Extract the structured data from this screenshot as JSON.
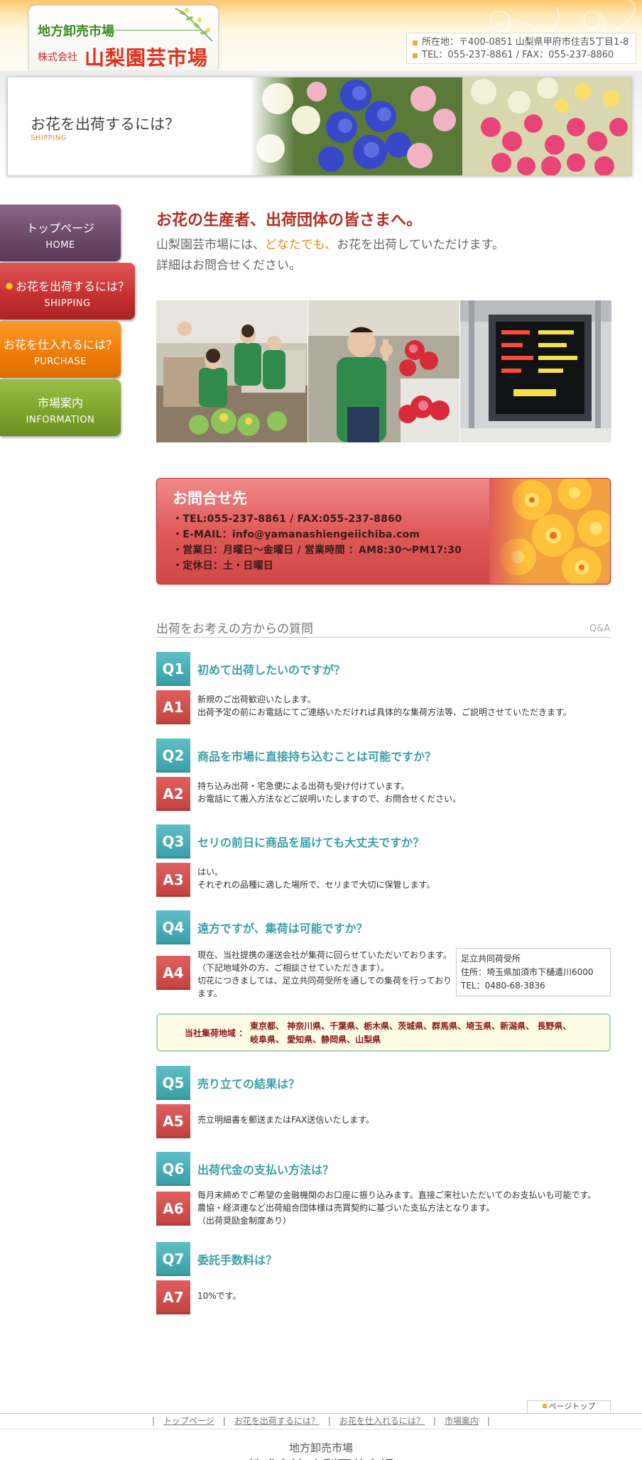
{
  "header": {
    "logo_line1": "地方卸売市場",
    "logo_company": "株式会社",
    "logo_name": "山梨園芸市場",
    "address": "所在地：〒400-0851 山梨県甲府市住吉5丁目1-8",
    "tel_fax": "TEL：055-237-8861 / FAX：055-237-8860"
  },
  "banner": {
    "title": "お花を出荷するには？",
    "subtitle": "SHIPPING"
  },
  "nav": [
    {
      "jp": "トップページ",
      "en": "HOME"
    },
    {
      "jp": "お花を出荷するには？",
      "en": "SHIPPING"
    },
    {
      "jp": "お花を仕入れるには？",
      "en": "PURCHASE"
    },
    {
      "jp": "市場案内",
      "en": "INFORMATION"
    }
  ],
  "intro": {
    "headline": "お花の生産者、出荷団体の皆さまへ。",
    "line2_a": "山梨園芸市場には、",
    "line2_highlight": "どなたでも、",
    "line2_b": "お花を出荷していただけます。",
    "line3": "詳細はお問合せください。"
  },
  "contact": {
    "title": "お問合せ先",
    "lines": [
      "・TEL:055-237-8861 / FAX:055-237-8860",
      "・E-MAIL：info@yamanashiengeiichiba.com",
      "・営業日：月曜日～金曜日 / 営業時間 ：AM8:30～PM17:30",
      "・定休日：土・日曜日"
    ]
  },
  "qa": {
    "heading": "出荷をお考えの方からの質問",
    "tag": "Q&A",
    "items": [
      {
        "q_badge": "Q1",
        "q": "初めて出荷したいのですが？",
        "a_badge": "A1",
        "a": [
          "新規のご出荷歓迎いたします。",
          "出荷予定の前にお電話にてご連絡いただければ具体的な集荷方法等、ご説明させていただきます。"
        ]
      },
      {
        "q_badge": "Q2",
        "q": "商品を市場に直接持ち込むことは可能ですか？",
        "a_badge": "A2",
        "a": [
          "持ち込み出荷・宅急便による出荷も受け付けています。",
          "お電話にて搬入方法などご説明いたしますので、お問合せください。"
        ]
      },
      {
        "q_badge": "Q3",
        "q": "セリの前日に商品を届けても大丈夫ですか？",
        "a_badge": "A3",
        "a": [
          "はい。",
          "それぞれの品種に適した場所で、セリまで大切に保管します。"
        ]
      },
      {
        "q_badge": "Q4",
        "q": "遠方ですが、集荷は可能ですか？",
        "a_badge": "A4",
        "a": [
          "現在、当社提携の運送会社が集荷に回らせていただいております。",
          "（下記地域外の方、ご相談させていただきます）。",
          "切花につきましては、足立共同荷受所を通しての集荷を行っており",
          "ます。"
        ]
      },
      {
        "q_badge": "Q5",
        "q": "売り立ての結果は？",
        "a_badge": "A5",
        "a": [
          "売立明細書を郵送またはFAX送信いたします。"
        ]
      },
      {
        "q_badge": "Q6",
        "q": "出荷代金の支払い方法は？",
        "a_badge": "A6",
        "a": [
          "毎月末締めでご希望の金融機関のお口座に振り込みます。直接ご来社いただいてのお支払いも可能です。",
          "農協・経済連など出荷組合団体様は売買契約に基づいた支払方法となります。",
          "（出荷奨励金制度あり）"
        ]
      },
      {
        "q_badge": "Q7",
        "q": "委託手数料は？",
        "a_badge": "A7",
        "a": [
          "10%です。"
        ]
      }
    ],
    "side_info": [
      "足立共同荷受所",
      "住所：埼玉県加須市下樋遣川6000",
      "TEL：0480-68-3836"
    ],
    "region_label": "当社集荷地域 ：",
    "region_lines": [
      "東京都、 神奈川県、千葉県、栃木県、茨城県、群馬県、埼玉県、新潟県、 長野県、",
      "岐阜県、 愛知県、静岡県、山梨県"
    ]
  },
  "footer": {
    "pagetop": "ページトップ",
    "nav": [
      "トップページ",
      "お花を出荷するには？",
      "お花を仕入れるには？",
      "市場案内"
    ],
    "sep": "|",
    "logo_line1": "地方卸売市場",
    "logo_line2": "株式会社 山梨園芸市場"
  }
}
